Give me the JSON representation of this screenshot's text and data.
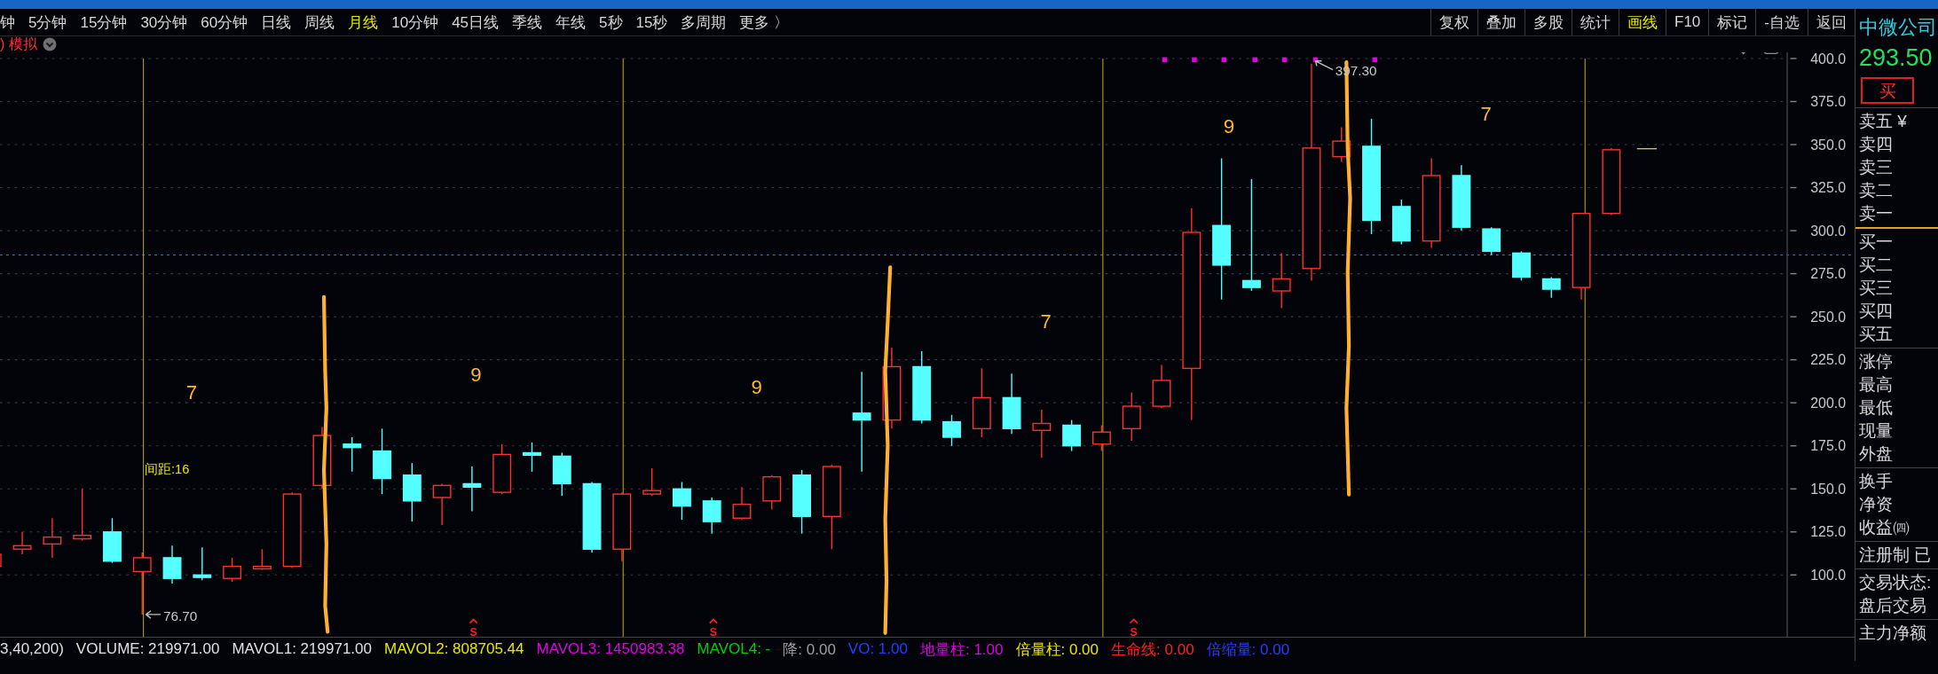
{
  "top_bar": {
    "periods": [
      {
        "label": "钟",
        "selected": false
      },
      {
        "label": "5分钟",
        "selected": false
      },
      {
        "label": "15分钟",
        "selected": false
      },
      {
        "label": "30分钟",
        "selected": false
      },
      {
        "label": "60分钟",
        "selected": false
      },
      {
        "label": "日线",
        "selected": false
      },
      {
        "label": "周线",
        "selected": false
      },
      {
        "label": "月线",
        "selected": true
      },
      {
        "label": "10分钟",
        "selected": false
      },
      {
        "label": "45日线",
        "selected": false
      },
      {
        "label": "季线",
        "selected": false
      },
      {
        "label": "年线",
        "selected": false
      },
      {
        "label": "5秒",
        "selected": false
      },
      {
        "label": "15秒",
        "selected": false
      },
      {
        "label": "多周期",
        "selected": false
      },
      {
        "label": "更多 〉",
        "selected": false
      }
    ],
    "tools": [
      {
        "label": "复权",
        "selected": false
      },
      {
        "label": "叠加",
        "selected": false
      },
      {
        "label": "多股",
        "selected": false
      },
      {
        "label": "统计",
        "selected": false
      },
      {
        "label": "画线",
        "selected": true
      },
      {
        "label": "F10",
        "selected": false
      },
      {
        "label": "标记",
        "selected": false
      },
      {
        "label": "-自选",
        "selected": false
      },
      {
        "label": "返回",
        "selected": false
      }
    ]
  },
  "mode": {
    "prefix": ")",
    "label": "模拟"
  },
  "chart": {
    "y_labels": [
      "400.0",
      "375.0",
      "350.0",
      "325.0",
      "300.0",
      "275.0",
      "250.0",
      "225.0",
      "200.0",
      "175.0",
      "150.0",
      "125.0",
      "100.0"
    ],
    "count_labels": [
      "7",
      "9",
      "9",
      "7",
      "9",
      "7"
    ],
    "spacing_label": "间距:16",
    "low_label": "76.70",
    "high_label": "397.30",
    "signal_marks": [
      "S",
      "S",
      "S"
    ]
  },
  "indicators": [
    {
      "text": "3,40,200)",
      "color": "#e0e0e0"
    },
    {
      "text": "VOLUME: 219971.00",
      "color": "#e0e0e0"
    },
    {
      "text": "MAVOL1: 219971.00",
      "color": "#e0e0e0"
    },
    {
      "text": "MAVOL2: 808705.44",
      "color": "#e8e800"
    },
    {
      "text": "MAVOL3: 1450983.38",
      "color": "#e000e0"
    },
    {
      "text": "MAVOL4: -",
      "color": "#00d000"
    },
    {
      "text": "降: 0.00",
      "color": "#a0a0a0"
    },
    {
      "text": "VO: 1.00",
      "color": "#2040ff"
    },
    {
      "text": "地量柱: 1.00",
      "color": "#e000e0"
    },
    {
      "text": "倍量柱: 0.00",
      "color": "#e8e800"
    },
    {
      "text": "生命线: 0.00",
      "color": "#ff2020"
    },
    {
      "text": "倍缩量: 0.00",
      "color": "#2040ff"
    }
  ],
  "quote": {
    "name": "中微公司",
    "price": "293.50",
    "buy_button": "买",
    "groups": [
      {
        "kind": "ask",
        "rows": [
          "卖五 ¥",
          "卖四",
          "卖三",
          "卖二",
          "卖一"
        ]
      },
      {
        "kind": "plain",
        "rows": [
          "买一",
          "买二",
          "买三",
          "买四",
          "买五"
        ]
      },
      {
        "kind": "plain",
        "rows": [
          "涨停",
          "最高",
          "最低",
          "现量",
          "外盘"
        ]
      },
      {
        "kind": "plain",
        "rows": [
          "换手",
          "净资",
          "收益㈣"
        ]
      },
      {
        "kind": "plain",
        "rows": [
          "注册制 已"
        ]
      },
      {
        "kind": "plain",
        "rows": [
          "交易状态:",
          "盘后交易"
        ]
      },
      {
        "kind": "plain",
        "rows": [
          "主力净额"
        ]
      }
    ]
  }
}
